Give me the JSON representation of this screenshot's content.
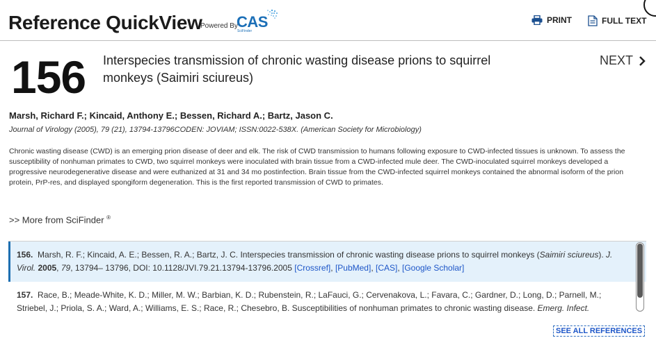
{
  "header": {
    "title": "Reference QuickView",
    "powered_by": "Powered By",
    "logo_text": "CAS",
    "logo_sub": "SciFinder",
    "print_label": "PRINT",
    "full_text_label": "FULL TEXT"
  },
  "article": {
    "ref_number": "156",
    "title": "Interspecies transmission of chronic wasting disease prions to squirrel monkeys (Saimiri sciureus)",
    "next_label": "NEXT",
    "authors": "Marsh, Richard F.; Kincaid, Anthony E.; Bessen, Richard A.; Bartz, Jason C.",
    "journal": "Journal of Virology (2005), 79 (21), 13794-13796CODEN: JOVIAM; ISSN:0022-538X. (American Society for Microbiology)",
    "abstract": "Chronic wasting disease (CWD) is an emerging prion disease of deer and elk. The risk of CWD transmission to humans following exposure to CWD-infected tissues is unknown. To assess the susceptibility of nonhuman primates to CWD, two squirrel monkeys were inoculated with brain tissue from a CWD-infected mule deer. The CWD-inoculated squirrel monkeys developed a progressive neurodegenerative disease and were euthanized at 31 and 34 mo postinfection. Brain tissue from the CWD-infected squirrel monkeys contained the abnormal isoform of the prion protein, PrP-res, and displayed spongiform degeneration. This is the first reported transmission of CWD to primates.",
    "more_label": ">> More from SciFinder",
    "more_sup": "®"
  },
  "references": [
    {
      "num": "156.",
      "authors": "Marsh, R. F.; Kincaid, A. E.; Bessen, R. A.; Bartz, J. C. Interspecies transmission of chronic wasting disease prions to squirrel monkeys (",
      "species": "Saimiri sciureus",
      "after_species": "). ",
      "journal": "J. Virol.",
      "year": "2005",
      "volume": "79",
      "pages": ", 13794– 13796,  DOI: 10.1128/JVI.79.21.13794-13796.2005  ",
      "links": [
        "[Crossref]",
        "[PubMed]",
        "[CAS]",
        "[Google Scholar]"
      ]
    },
    {
      "num": "157.",
      "text": "Race, B.; Meade-White, K. D.; Miller, M. W.; Barbian, K. D.; Rubenstein, R.; LaFauci, G.; Cervenakova, L.; Favara, C.; Gardner, D.; Long, D.; Parnell, M.; Striebel, J.; Priola, S. A.; Ward, A.; Williams, E. S.; Race, R.; Chesebro, B. Susceptibilities of nonhuman primates to chronic wasting disease. ",
      "journal": "Emerg. Infect."
    }
  ],
  "see_all_label": "SEE ALL REFERENCES",
  "colors": {
    "accent": "#1d6fb1",
    "link": "#1d56c8",
    "highlight_bg": "#e4f1fb"
  }
}
